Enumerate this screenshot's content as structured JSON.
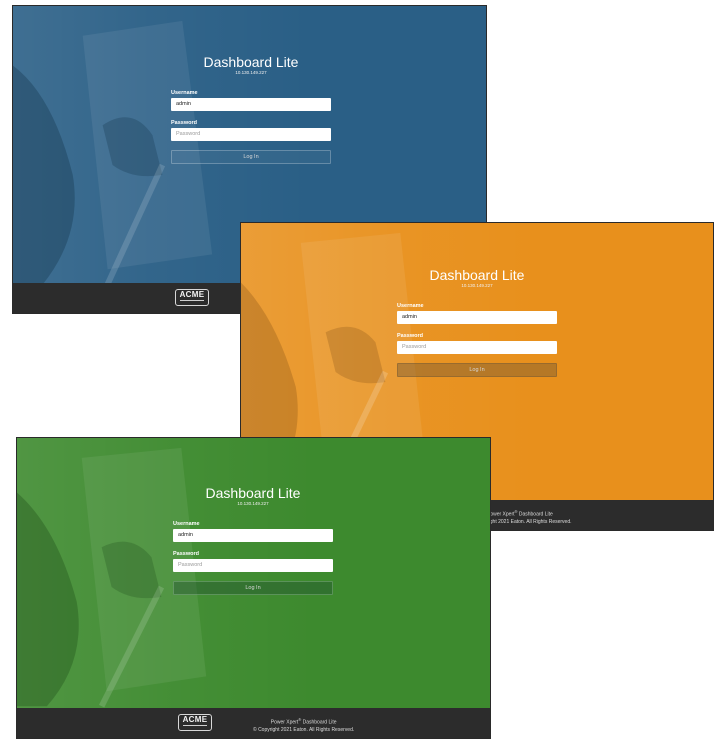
{
  "colors": {
    "blue_panel": "#2a5f86",
    "orange_panel": "#e8901c",
    "green_panel": "#3d8a2e",
    "footer": "#2c2c2c"
  },
  "login": {
    "title": "Dashboard Lite",
    "ip": "10.130.149.227",
    "username_label": "Username",
    "username_value": "admin",
    "password_label": "Password",
    "password_placeholder": "Password",
    "login_button": "Log In"
  },
  "footer": {
    "logo_text": "ACME",
    "product_line_prefix": "Power Xpert",
    "product_line_mark": "®",
    "product_line_suffix": " Dashboard Lite",
    "copyright": "© Copyright 2021 Eaton. All Rights Reserved.",
    "copyright_cropped": "right 2021 Eaton. All Rights Reserved."
  }
}
